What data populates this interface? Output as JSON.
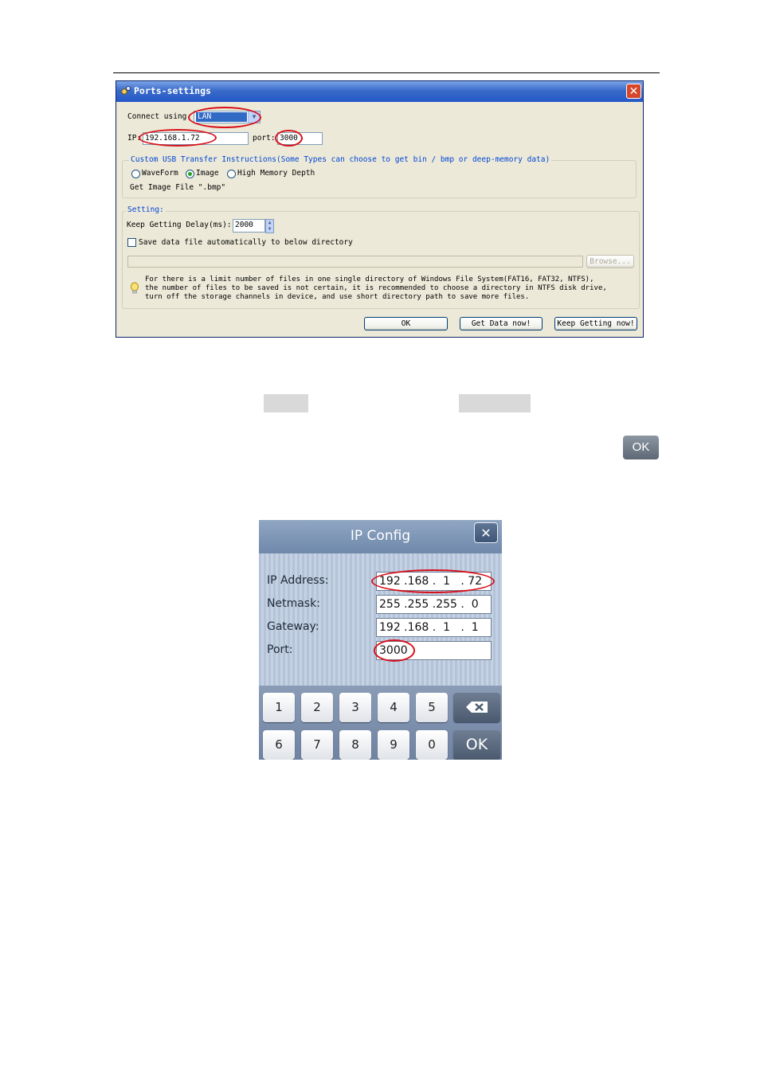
{
  "ports_dialog": {
    "title": "Ports-settings",
    "close_label": "✕",
    "connect_using_label": "Connect using",
    "connect_using_value": "LAN",
    "ip_label": "IP:",
    "ip_value": "192.168.1.72",
    "port_label": "port:",
    "port_value": "3000",
    "usb_group_title": "Custom USB Transfer Instructions(Some Types can choose to get bin / bmp or deep-memory data)",
    "radio_waveform": "WaveForm",
    "radio_image": "Image",
    "radio_high_memory": "High Memory Depth",
    "get_file_text": "Get Image File \".bmp\"",
    "setting_group_title": "Setting:",
    "keep_delay_label": "Keep Getting Delay(ms):",
    "keep_delay_value": "2000",
    "save_checkbox_label": "Save data file automatically to below directory",
    "browse_label": "Browse...",
    "tip_line1": "For there is a limit number of files in one single directory of Windows File System(FAT16, FAT32, NTFS),",
    "tip_line2": "the number of  files to be saved is not certain,  it is recommended to choose a directory in NTFS disk drive,",
    "tip_line3": "turn off the storage channels in device, and use short directory path to save more files.",
    "ok_label": "OK",
    "get_data_label": "Get Data now!",
    "keep_getting_label": "Keep Getting now!"
  },
  "ok_chip_label": "OK",
  "ip_config": {
    "title": "IP Config",
    "close_label": "✕",
    "ip_label": "IP Address:",
    "ip_value": "192 .168 .  1   . 72",
    "netmask_label": "Netmask:",
    "netmask_value": "255 .255 .255 .  0",
    "gateway_label": "Gateway:",
    "gateway_value": "192 .168 .  1   .  1",
    "port_label": "Port:",
    "port_value": "3000",
    "keys_row1": [
      "1",
      "2",
      "3",
      "4",
      "5"
    ],
    "keys_row2": [
      "6",
      "7",
      "8",
      "9",
      "0"
    ],
    "backspace_icon": "backspace-icon",
    "ok_label": "OK"
  }
}
